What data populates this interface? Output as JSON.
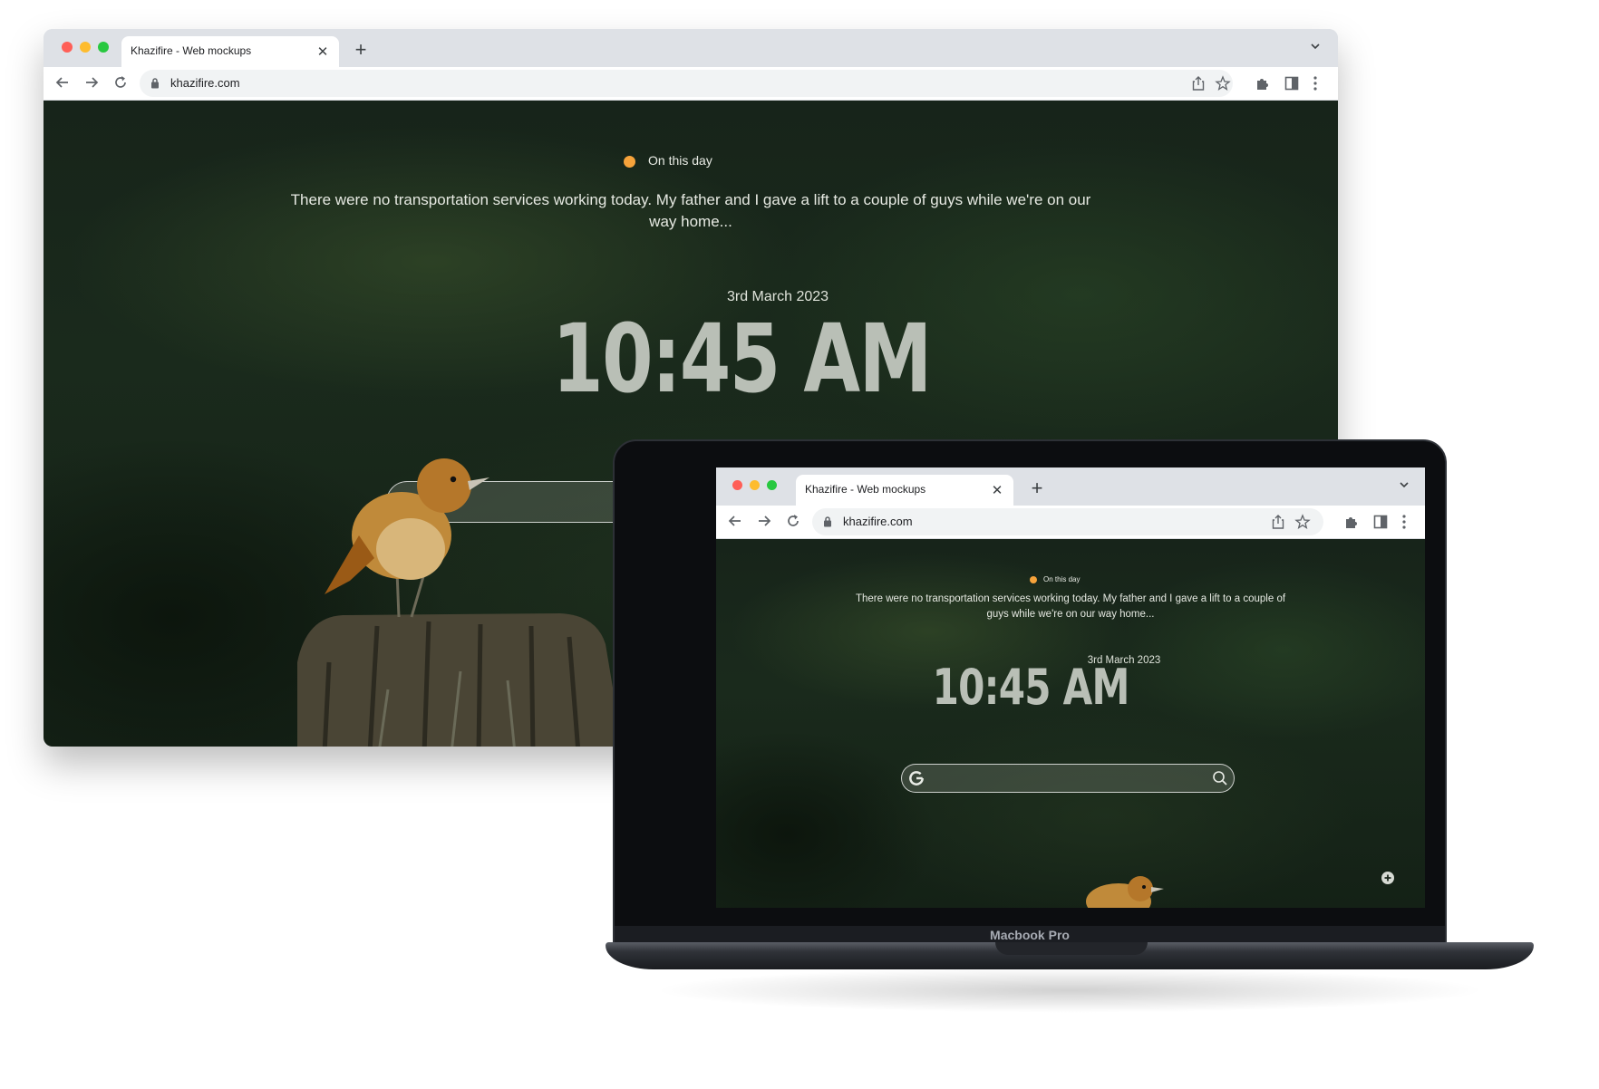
{
  "desktop": {
    "tab_title": "Khazifire - Web mockups",
    "url": "khazifire.com",
    "on_this_day": "On this day",
    "quote": "There were no transportation services working today. My father and I gave a lift to a couple of guys while we're on our way home...",
    "date": "3rd March 2023",
    "time": "10:45 AM"
  },
  "laptop": {
    "tab_title": "Khazifire - Web mockups",
    "url": "khazifire.com",
    "on_this_day": "On this day",
    "quote": "There were no transportation services working today. My father and I gave a lift to a couple of guys while we're on our way home...",
    "date": "3rd March 2023",
    "time": "10:45 AM",
    "device_label": "Macbook Pro"
  },
  "colors": {
    "accent_dot": "#f6a33b",
    "close": "#ff5f57",
    "minimize": "#febc2e",
    "maximize": "#28c840"
  },
  "icons": [
    "back-arrow-icon",
    "forward-arrow-icon",
    "reload-icon",
    "lock-icon",
    "share-icon",
    "bookmark-star-icon",
    "extensions-icon",
    "side-panel-icon",
    "kebab-menu-icon",
    "google-g-icon",
    "search-icon",
    "add-icon",
    "chevron-down-icon",
    "close-icon",
    "plus-icon"
  ]
}
